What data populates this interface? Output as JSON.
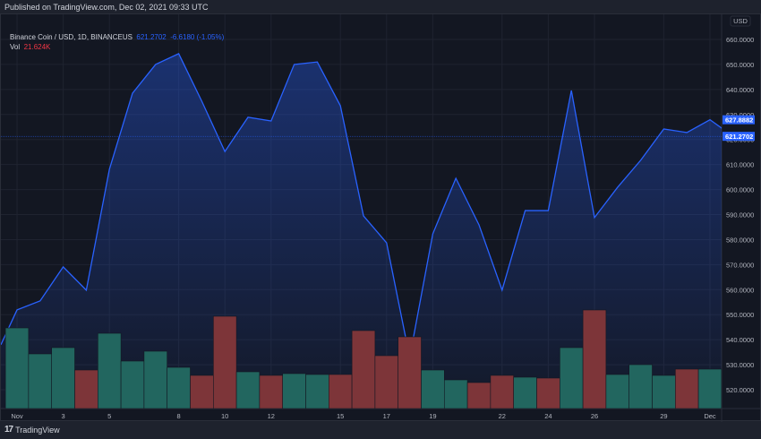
{
  "published": "Published on TradingView.com, Dec 02, 2021 09:33 UTC",
  "legend": {
    "symbol": "Binance Coin / USD, 1D, BINANCEUS",
    "last": "621.2702",
    "change": "-6.6180 (-1.05%)",
    "vol_label": "Vol",
    "vol_value": "21.624K"
  },
  "currency": "USD",
  "footer": {
    "logo": "17",
    "brand": "TradingView"
  },
  "price_tags": {
    "high_label": "627.8882",
    "last_label": "621.2702"
  },
  "colors": {
    "line": "#2962ff",
    "up": "#22665f",
    "down": "#7d3539",
    "bg": "#131722"
  },
  "chart_data": {
    "type": "area",
    "title": "Binance Coin / USD, 1D",
    "x_tick_labels": [
      {
        "i": 0,
        "t": "Nov"
      },
      {
        "i": 2,
        "t": "3"
      },
      {
        "i": 4,
        "t": "5"
      },
      {
        "i": 7,
        "t": "8"
      },
      {
        "i": 9,
        "t": "10"
      },
      {
        "i": 11,
        "t": "12"
      },
      {
        "i": 14,
        "t": "15"
      },
      {
        "i": 16,
        "t": "17"
      },
      {
        "i": 18,
        "t": "19"
      },
      {
        "i": 21,
        "t": "22"
      },
      {
        "i": 23,
        "t": "24"
      },
      {
        "i": 25,
        "t": "26"
      },
      {
        "i": 28,
        "t": "29"
      },
      {
        "i": 30,
        "t": "Dec"
      }
    ],
    "y_ticks": [
      520,
      530,
      540,
      550,
      560,
      570,
      580,
      590,
      600,
      610,
      620,
      630,
      640,
      650,
      660
    ],
    "ylim": [
      515,
      665
    ],
    "close": [
      551.9,
      555.5,
      569.1,
      559.8,
      608.1,
      638.5,
      650.0,
      654.3,
      635.3,
      615.2,
      628.9,
      627.4,
      650.0,
      651.0,
      633.5,
      589.5,
      578.7,
      532.9,
      582.3,
      604.5,
      585.9,
      559.8,
      591.6,
      591.6,
      639.6,
      588.8,
      600.9,
      611.7,
      624.2,
      622.8,
      627.9,
      621.27
    ],
    "prev_close": 538,
    "volume_relative": [
      90,
      61,
      68,
      43,
      84,
      53,
      64,
      46,
      37,
      103,
      41,
      37,
      39,
      38,
      38,
      87,
      59,
      80,
      43,
      32,
      29,
      37,
      35,
      34,
      68,
      110,
      38,
      49,
      37,
      44,
      44
    ],
    "volume_up": [
      1,
      1,
      1,
      0,
      1,
      1,
      1,
      1,
      0,
      0,
      1,
      0,
      1,
      1,
      0,
      0,
      0,
      0,
      1,
      1,
      0,
      0,
      1,
      0,
      1,
      0,
      1,
      1,
      1,
      0,
      1
    ]
  }
}
